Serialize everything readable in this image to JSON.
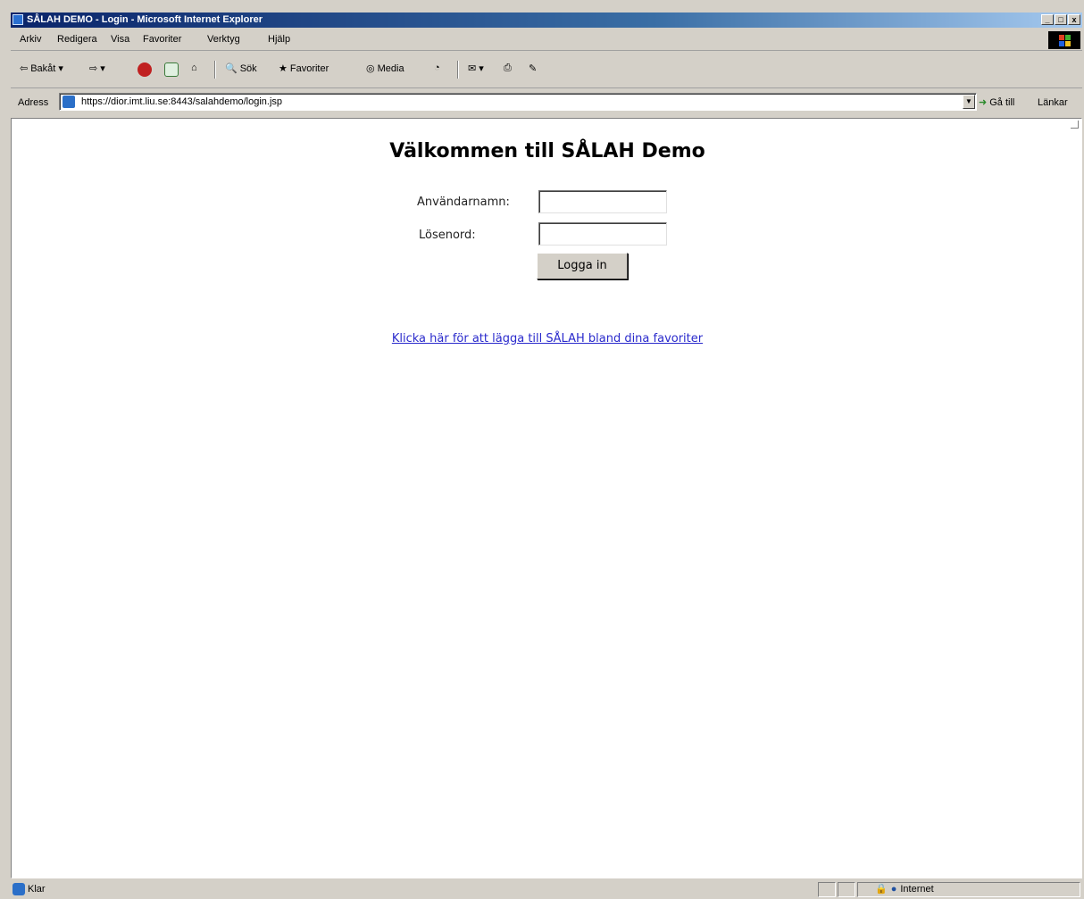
{
  "window": {
    "title": "SÅLAH DEMO - Login - Microsoft Internet Explorer",
    "controls": [
      "_",
      "□",
      "x"
    ]
  },
  "menu": [
    "Arkiv",
    "Redigera",
    "Visa",
    "Favoriter",
    "Verktyg",
    "Hjälp"
  ],
  "toolbar": {
    "back": "Bakåt",
    "search": "Sök",
    "favorites": "Favoriter",
    "media": "Media"
  },
  "address": {
    "label": "Adress",
    "url": "https://dior.imt.liu.se:8443/salahdemo/login.jsp",
    "go": "Gå till",
    "links": "Länkar"
  },
  "page": {
    "heading": "Välkommen till SÅLAH Demo",
    "username_label": "Användarnamn:",
    "password_label": "Lösenord:",
    "username_value": "",
    "password_value": "",
    "login_button": "Logga in",
    "favorites_link": "Klicka här för att lägga till SÅLAH bland dina favoriter"
  },
  "status": {
    "text": "Klar",
    "zone": "Internet"
  },
  "colors": {
    "titlebar_start": "#0a246a",
    "titlebar_end": "#a6caf0",
    "chrome": "#d4d0c8",
    "link": "#2a2acc"
  }
}
